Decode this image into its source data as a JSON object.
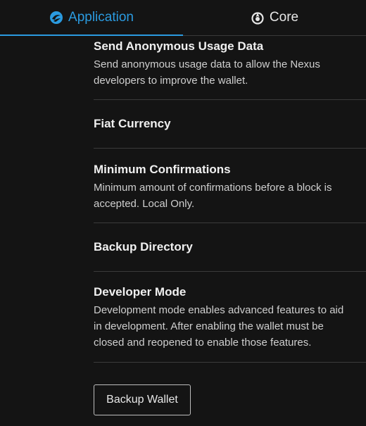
{
  "tabs": [
    {
      "label": "Application",
      "icon": "nexus-logo-icon",
      "active": true
    },
    {
      "label": "Core",
      "icon": "core-icon",
      "active": false
    }
  ],
  "settings": [
    {
      "title": "Send Anonymous Usage Data",
      "description": "Send anonymous usage data to allow the Nexus developers to improve the wallet."
    },
    {
      "title": "Fiat Currency",
      "description": ""
    },
    {
      "title": "Minimum Confirmations",
      "description": "Minimum amount of confirmations before a block is accepted. Local Only."
    },
    {
      "title": "Backup Directory",
      "description": ""
    },
    {
      "title": "Developer Mode",
      "description": "Development mode enables advanced features to aid in development. After enabling the wallet must be closed and reopened to enable those features."
    }
  ],
  "backup_button": {
    "label": "Backup Wallet"
  },
  "colors": {
    "accent": "#2b9be0",
    "background": "#141414"
  }
}
